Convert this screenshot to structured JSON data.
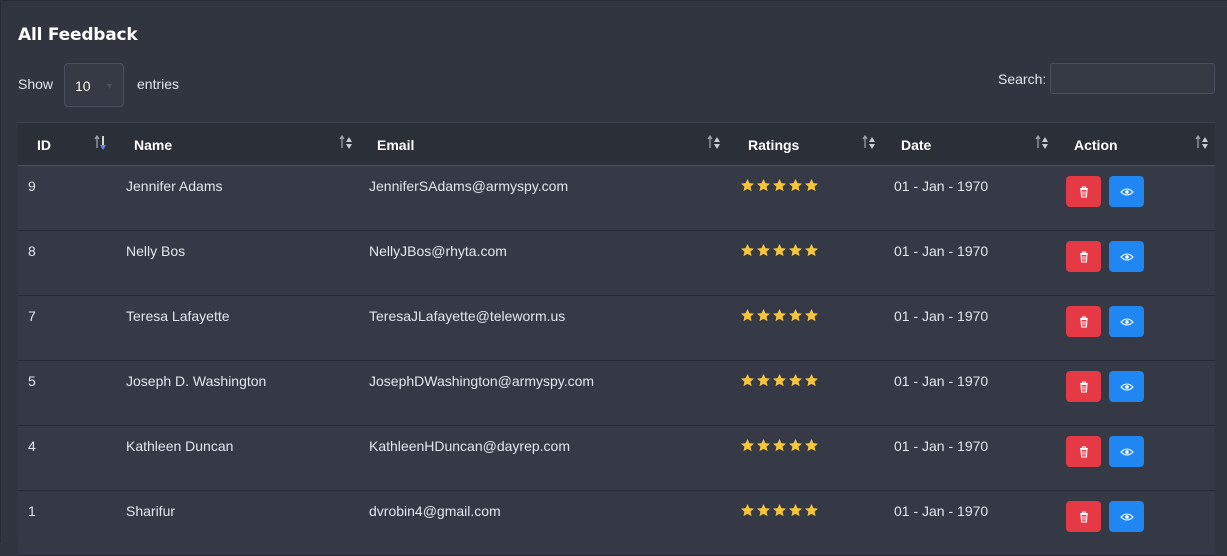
{
  "title": "All Feedback",
  "length": {
    "show_label": "Show",
    "selected": "10",
    "entries_label": "entries"
  },
  "search": {
    "label": "Search:",
    "value": ""
  },
  "columns": [
    "ID",
    "Name",
    "Email",
    "Ratings",
    "Date",
    "Action"
  ],
  "rows": [
    {
      "id": "9",
      "name": "Jennifer Adams",
      "email": "JenniferSAdams@armyspy.com",
      "rating": 5,
      "date": "01 - Jan - 1970"
    },
    {
      "id": "8",
      "name": "Nelly Bos",
      "email": "NellyJBos@rhyta.com",
      "rating": 5,
      "date": "01 - Jan - 1970"
    },
    {
      "id": "7",
      "name": "Teresa Lafayette",
      "email": "TeresaJLafayette@teleworm.us",
      "rating": 5,
      "date": "01 - Jan - 1970"
    },
    {
      "id": "5",
      "name": "Joseph D. Washington",
      "email": "JosephDWashington@armyspy.com",
      "rating": 5,
      "date": "01 - Jan - 1970"
    },
    {
      "id": "4",
      "name": "Kathleen Duncan",
      "email": "KathleenHDuncan@dayrep.com",
      "rating": 5,
      "date": "01 - Jan - 1970"
    },
    {
      "id": "1",
      "name": "Sharifur",
      "email": "dvrobin4@gmail.com",
      "rating": 5,
      "date": "01 - Jan - 1970"
    }
  ],
  "colors": {
    "star": "#f7c53c",
    "delete_button": "#e53a46",
    "view_button": "#1f86f2"
  },
  "icons": {
    "delete": "trash-icon",
    "view": "eye-icon",
    "rating": "star-icon"
  }
}
